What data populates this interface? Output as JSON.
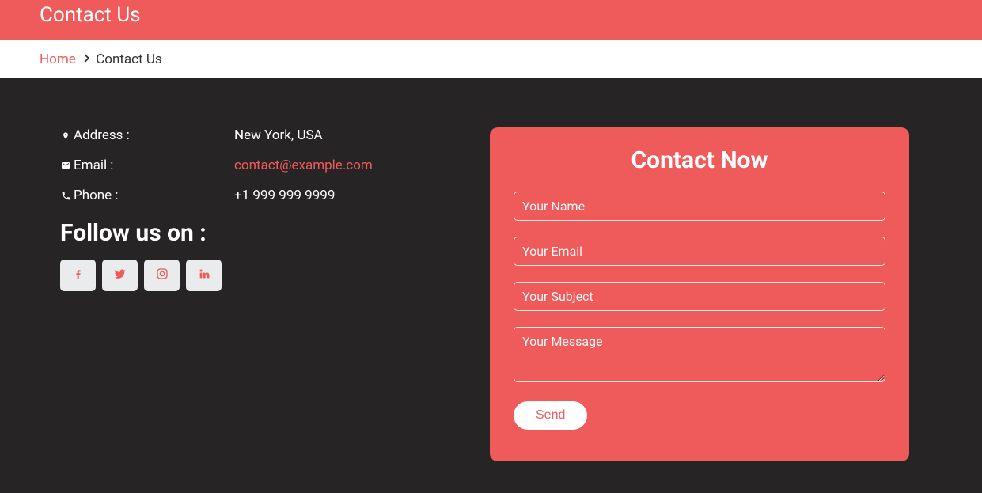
{
  "header": {
    "title": "Contact Us"
  },
  "breadcrumb": {
    "home": "Home",
    "current": "Contact Us"
  },
  "info": {
    "address_label": "Address :",
    "address_value": "New York, USA",
    "email_label": "Email :",
    "email_value": "contact@example.com",
    "phone_label": "Phone :",
    "phone_value": "+1 999 999 9999"
  },
  "follow": {
    "heading": "Follow us on :"
  },
  "form": {
    "title": "Contact Now",
    "name_placeholder": "Your Name",
    "email_placeholder": "Your Email",
    "subject_placeholder": "Your Subject",
    "message_placeholder": "Your Message",
    "send_label": "Send"
  },
  "colors": {
    "accent": "#ef5a5a",
    "dark_bg": "#262424"
  }
}
